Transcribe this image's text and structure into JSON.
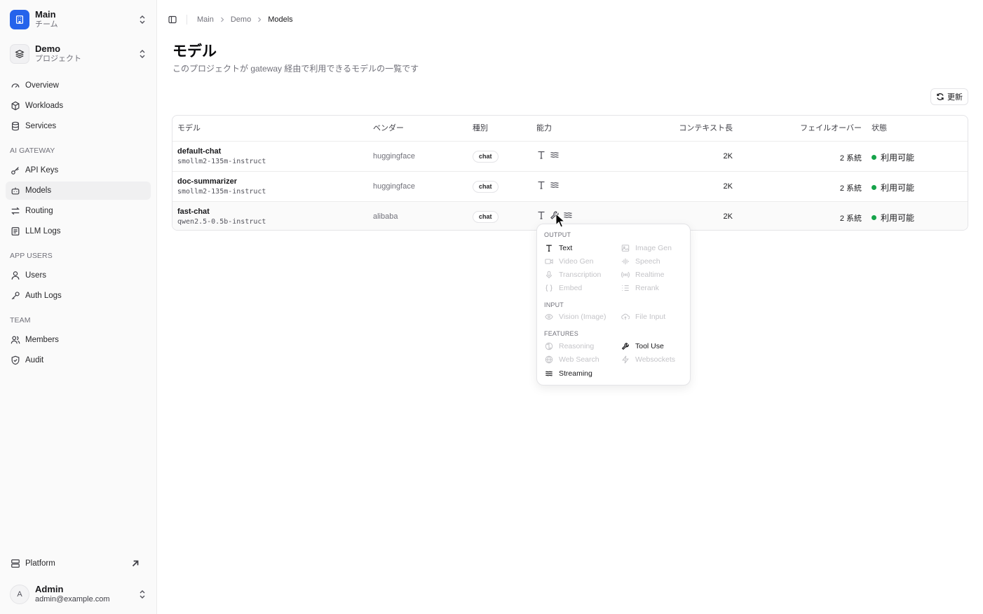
{
  "sidebar": {
    "team": {
      "name": "Main",
      "sub": "チーム"
    },
    "project": {
      "name": "Demo",
      "sub": "プロジェクト"
    },
    "nav_top": [
      {
        "label": "Overview"
      },
      {
        "label": "Workloads"
      },
      {
        "label": "Services"
      }
    ],
    "section_gateway": "AI GATEWAY",
    "nav_gateway": [
      {
        "label": "API Keys"
      },
      {
        "label": "Models"
      },
      {
        "label": "Routing"
      },
      {
        "label": "LLM Logs"
      }
    ],
    "section_users": "APP USERS",
    "nav_users": [
      {
        "label": "Users"
      },
      {
        "label": "Auth Logs"
      }
    ],
    "section_team": "TEAM",
    "nav_team": [
      {
        "label": "Members"
      },
      {
        "label": "Audit"
      }
    ],
    "platform_label": "Platform",
    "user": {
      "initial": "A",
      "name": "Admin",
      "email": "admin@example.com"
    }
  },
  "breadcrumb": [
    "Main",
    "Demo",
    "Models"
  ],
  "page": {
    "title": "モデル",
    "subtitle": "このプロジェクトが gateway 経由で利用できるモデルの一覧です",
    "refresh_label": "更新"
  },
  "table": {
    "headers": [
      "モデル",
      "ベンダー",
      "種別",
      "能力",
      "コンテキスト長",
      "フェイルオーバー",
      "状態"
    ],
    "rows": [
      {
        "name": "default-chat",
        "id": "smollm2-135m-instruct",
        "vendor": "huggingface",
        "kind": "chat",
        "context": "2K",
        "failover": "2 系統",
        "status": "利用可能"
      },
      {
        "name": "doc-summarizer",
        "id": "smollm2-135m-instruct",
        "vendor": "huggingface",
        "kind": "chat",
        "context": "2K",
        "failover": "2 系統",
        "status": "利用可能"
      },
      {
        "name": "fast-chat",
        "id": "qwen2.5-0.5b-instruct",
        "vendor": "alibaba",
        "kind": "chat",
        "context": "2K",
        "failover": "2 系統",
        "status": "利用可能"
      }
    ]
  },
  "popover": {
    "output_label": "OUTPUT",
    "output": [
      {
        "label": "Text",
        "enabled": true
      },
      {
        "label": "Image Gen",
        "enabled": false
      },
      {
        "label": "Video Gen",
        "enabled": false
      },
      {
        "label": "Speech",
        "enabled": false
      },
      {
        "label": "Transcription",
        "enabled": false
      },
      {
        "label": "Realtime",
        "enabled": false
      },
      {
        "label": "Embed",
        "enabled": false
      },
      {
        "label": "Rerank",
        "enabled": false
      }
    ],
    "input_label": "INPUT",
    "input": [
      {
        "label": "Vision (Image)",
        "enabled": false
      },
      {
        "label": "File Input",
        "enabled": false
      }
    ],
    "features_label": "FEATURES",
    "features": [
      {
        "label": "Reasoning",
        "enabled": false
      },
      {
        "label": "Tool Use",
        "enabled": true
      },
      {
        "label": "Web Search",
        "enabled": false
      },
      {
        "label": "Websockets",
        "enabled": false
      },
      {
        "label": "Streaming",
        "enabled": true
      }
    ]
  },
  "colors": {
    "accent": "#2563eb",
    "status_ok": "#16a34a"
  }
}
